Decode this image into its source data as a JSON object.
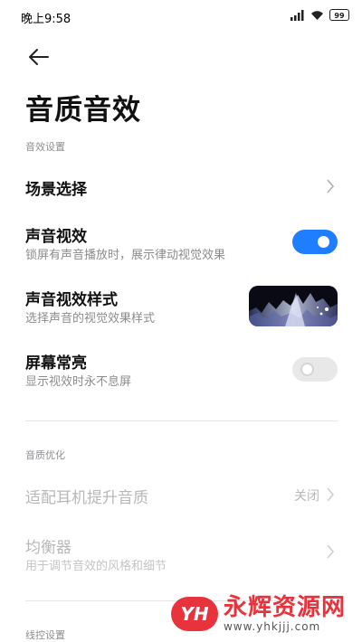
{
  "status_bar": {
    "time": "晚上9:58",
    "battery": "99"
  },
  "page": {
    "title": "音质音效"
  },
  "sections": {
    "effects": "音效设置",
    "quality": "音质优化",
    "remote": "线控设置"
  },
  "rows": {
    "scene": {
      "title": "场景选择"
    },
    "visual_effect": {
      "title": "声音视效",
      "subtitle": "锁屏有声音播放时，展示律动视觉效果",
      "enabled": true
    },
    "visual_style": {
      "title": "声音视效样式",
      "subtitle": "选择声音的视觉效果样式"
    },
    "always_on": {
      "title": "屏幕常亮",
      "subtitle": "显示视效时永不息屏",
      "enabled": false
    },
    "headphone": {
      "title": "适配耳机提升音质",
      "value": "关闭"
    },
    "equalizer": {
      "title": "均衡器",
      "subtitle": "用于调节音效的风格和细节"
    }
  },
  "watermark": {
    "logo": "YH",
    "name": "永辉资源网",
    "url": "www.yhkjjj.com"
  },
  "icons": [
    "back-arrow-icon",
    "chevron-right-icon",
    "signal-icon",
    "wifi-icon",
    "battery-icon"
  ],
  "colors": {
    "accent": "#1f7dff",
    "watermark": "#e8323c"
  }
}
